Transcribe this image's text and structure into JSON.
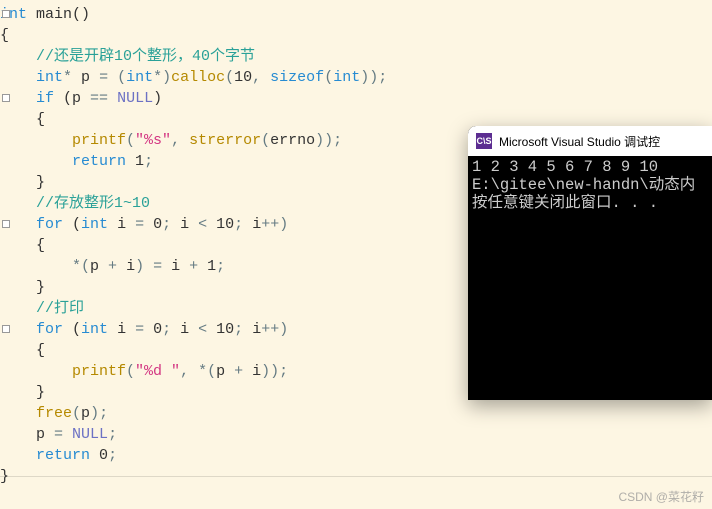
{
  "code": {
    "lines": [
      {
        "t": "plain",
        "indent": 0,
        "segs": [
          {
            "c": "type",
            "v": "int"
          },
          {
            "c": "",
            "v": " "
          },
          {
            "c": "func",
            "v": "main"
          },
          {
            "c": "",
            "v": "()"
          }
        ]
      },
      {
        "t": "plain",
        "indent": 0,
        "segs": [
          {
            "c": "",
            "v": "{"
          }
        ]
      },
      {
        "t": "comment",
        "indent": 1,
        "text": "//还是开辟10个整形，40个字节"
      },
      {
        "t": "plain",
        "indent": 1,
        "segs": [
          {
            "c": "type",
            "v": "int"
          },
          {
            "c": "op",
            "v": "* "
          },
          {
            "c": "",
            "v": "p "
          },
          {
            "c": "op",
            "v": "= ("
          },
          {
            "c": "type",
            "v": "int"
          },
          {
            "c": "op",
            "v": "*)"
          },
          {
            "c": "call",
            "v": "calloc"
          },
          {
            "c": "op",
            "v": "("
          },
          {
            "c": "num",
            "v": "10"
          },
          {
            "c": "op",
            "v": ", "
          },
          {
            "c": "kw",
            "v": "sizeof"
          },
          {
            "c": "op",
            "v": "("
          },
          {
            "c": "type",
            "v": "int"
          },
          {
            "c": "op",
            "v": "));"
          }
        ]
      },
      {
        "t": "plain",
        "indent": 1,
        "segs": [
          {
            "c": "kw",
            "v": "if"
          },
          {
            "c": "",
            "v": " (p "
          },
          {
            "c": "op",
            "v": "== "
          },
          {
            "c": "const",
            "v": "NULL"
          },
          {
            "c": "",
            "v": ")"
          }
        ]
      },
      {
        "t": "plain",
        "indent": 1,
        "segs": [
          {
            "c": "",
            "v": "{"
          }
        ]
      },
      {
        "t": "plain",
        "indent": 2,
        "segs": [
          {
            "c": "call",
            "v": "printf"
          },
          {
            "c": "op",
            "v": "("
          },
          {
            "c": "str",
            "v": "\"%s\""
          },
          {
            "c": "op",
            "v": ", "
          },
          {
            "c": "call",
            "v": "strerror"
          },
          {
            "c": "op",
            "v": "("
          },
          {
            "c": "",
            "v": "errno"
          },
          {
            "c": "op",
            "v": "));"
          }
        ]
      },
      {
        "t": "plain",
        "indent": 2,
        "segs": [
          {
            "c": "kw",
            "v": "return"
          },
          {
            "c": "",
            "v": " "
          },
          {
            "c": "num",
            "v": "1"
          },
          {
            "c": "op",
            "v": ";"
          }
        ]
      },
      {
        "t": "plain",
        "indent": 1,
        "segs": [
          {
            "c": "",
            "v": "}"
          }
        ]
      },
      {
        "t": "comment",
        "indent": 1,
        "text": "//存放整形1~10"
      },
      {
        "t": "plain",
        "indent": 1,
        "segs": [
          {
            "c": "kw",
            "v": "for"
          },
          {
            "c": "",
            "v": " ("
          },
          {
            "c": "type",
            "v": "int"
          },
          {
            "c": "",
            "v": " i "
          },
          {
            "c": "op",
            "v": "= "
          },
          {
            "c": "num",
            "v": "0"
          },
          {
            "c": "op",
            "v": "; "
          },
          {
            "c": "",
            "v": "i "
          },
          {
            "c": "op",
            "v": "< "
          },
          {
            "c": "num",
            "v": "10"
          },
          {
            "c": "op",
            "v": "; "
          },
          {
            "c": "",
            "v": "i"
          },
          {
            "c": "op",
            "v": "++)"
          }
        ]
      },
      {
        "t": "plain",
        "indent": 1,
        "segs": [
          {
            "c": "",
            "v": "{"
          }
        ]
      },
      {
        "t": "plain",
        "indent": 2,
        "segs": [
          {
            "c": "op",
            "v": "*("
          },
          {
            "c": "",
            "v": "p "
          },
          {
            "c": "op",
            "v": "+ "
          },
          {
            "c": "",
            "v": "i"
          },
          {
            "c": "op",
            "v": ") = "
          },
          {
            "c": "",
            "v": "i "
          },
          {
            "c": "op",
            "v": "+ "
          },
          {
            "c": "num",
            "v": "1"
          },
          {
            "c": "op",
            "v": ";"
          }
        ]
      },
      {
        "t": "plain",
        "indent": 1,
        "segs": [
          {
            "c": "",
            "v": "}"
          }
        ]
      },
      {
        "t": "comment",
        "indent": 1,
        "text": "//打印"
      },
      {
        "t": "plain",
        "indent": 1,
        "segs": [
          {
            "c": "kw",
            "v": "for"
          },
          {
            "c": "",
            "v": " ("
          },
          {
            "c": "type",
            "v": "int"
          },
          {
            "c": "",
            "v": " i "
          },
          {
            "c": "op",
            "v": "= "
          },
          {
            "c": "num",
            "v": "0"
          },
          {
            "c": "op",
            "v": "; "
          },
          {
            "c": "",
            "v": "i "
          },
          {
            "c": "op",
            "v": "< "
          },
          {
            "c": "num",
            "v": "10"
          },
          {
            "c": "op",
            "v": "; "
          },
          {
            "c": "",
            "v": "i"
          },
          {
            "c": "op",
            "v": "++)"
          }
        ]
      },
      {
        "t": "plain",
        "indent": 1,
        "segs": [
          {
            "c": "",
            "v": "{"
          }
        ]
      },
      {
        "t": "plain",
        "indent": 2,
        "segs": [
          {
            "c": "call",
            "v": "printf"
          },
          {
            "c": "op",
            "v": "("
          },
          {
            "c": "str",
            "v": "\"%d \""
          },
          {
            "c": "op",
            "v": ", *("
          },
          {
            "c": "",
            "v": "p "
          },
          {
            "c": "op",
            "v": "+ "
          },
          {
            "c": "",
            "v": "i"
          },
          {
            "c": "op",
            "v": "));"
          }
        ]
      },
      {
        "t": "plain",
        "indent": 1,
        "segs": [
          {
            "c": "",
            "v": "}"
          }
        ]
      },
      {
        "t": "plain",
        "indent": 1,
        "segs": [
          {
            "c": "call",
            "v": "free"
          },
          {
            "c": "op",
            "v": "("
          },
          {
            "c": "",
            "v": "p"
          },
          {
            "c": "op",
            "v": ");"
          }
        ]
      },
      {
        "t": "plain",
        "indent": 1,
        "segs": [
          {
            "c": "",
            "v": "p "
          },
          {
            "c": "op",
            "v": "= "
          },
          {
            "c": "const",
            "v": "NULL"
          },
          {
            "c": "op",
            "v": ";"
          }
        ]
      },
      {
        "t": "plain",
        "indent": 1,
        "segs": [
          {
            "c": "kw",
            "v": "return"
          },
          {
            "c": "",
            "v": " "
          },
          {
            "c": "num",
            "v": "0"
          },
          {
            "c": "op",
            "v": ";"
          }
        ]
      },
      {
        "t": "plain",
        "indent": 0,
        "segs": [
          {
            "c": "",
            "v": "}"
          }
        ]
      }
    ],
    "fold_markers": [
      0,
      4,
      10,
      15
    ]
  },
  "console": {
    "icon_text": "C\\S",
    "title": "Microsoft Visual Studio 调试控",
    "lines": [
      "1 2 3 4 5 6 7 8 9 10",
      "E:\\gitee\\new-handn\\动态内",
      "按任意键关闭此窗口. . ."
    ]
  },
  "watermark": "CSDN @菜花籽"
}
